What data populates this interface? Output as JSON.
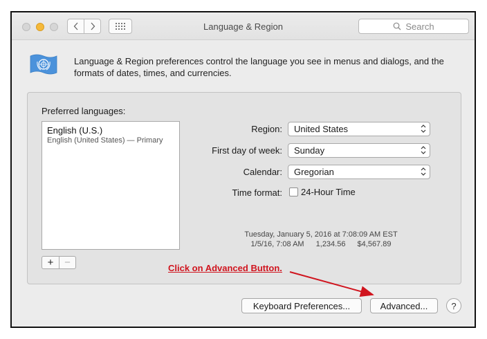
{
  "window": {
    "title": "Language & Region"
  },
  "search": {
    "placeholder": "Search"
  },
  "intro": {
    "text": "Language & Region preferences control the language you see in menus and dialogs, and the formats of dates, times, and currencies."
  },
  "languages": {
    "label": "Preferred languages:",
    "items": [
      {
        "name": "English (U.S.)",
        "detail": "English (United States) — Primary"
      }
    ],
    "add": "+",
    "remove": "−"
  },
  "settings": {
    "region": {
      "label": "Region:",
      "value": "United States"
    },
    "first_day": {
      "label": "First day of week:",
      "value": "Sunday"
    },
    "calendar": {
      "label": "Calendar:",
      "value": "Gregorian"
    },
    "time_format": {
      "label": "Time format:",
      "checkbox_label": "24-Hour Time",
      "checked": false
    }
  },
  "sample": {
    "long": "Tuesday, January 5, 2016 at 7:08:09 AM EST",
    "short_date": "1/5/16, 7:08 AM",
    "number": "1,234.56",
    "currency": "$4,567.89"
  },
  "annotation": {
    "text": "Click on Advanced Button.",
    "color": "#d0141e"
  },
  "buttons": {
    "keyboard": "Keyboard Preferences...",
    "advanced": "Advanced...",
    "help": "?"
  },
  "icons": [
    "close-light",
    "minimize-light",
    "zoom-light",
    "chevron-left-icon",
    "chevron-right-icon",
    "grid-icon",
    "search-icon",
    "un-flag-icon",
    "stepper-arrows-icon",
    "help-icon"
  ]
}
